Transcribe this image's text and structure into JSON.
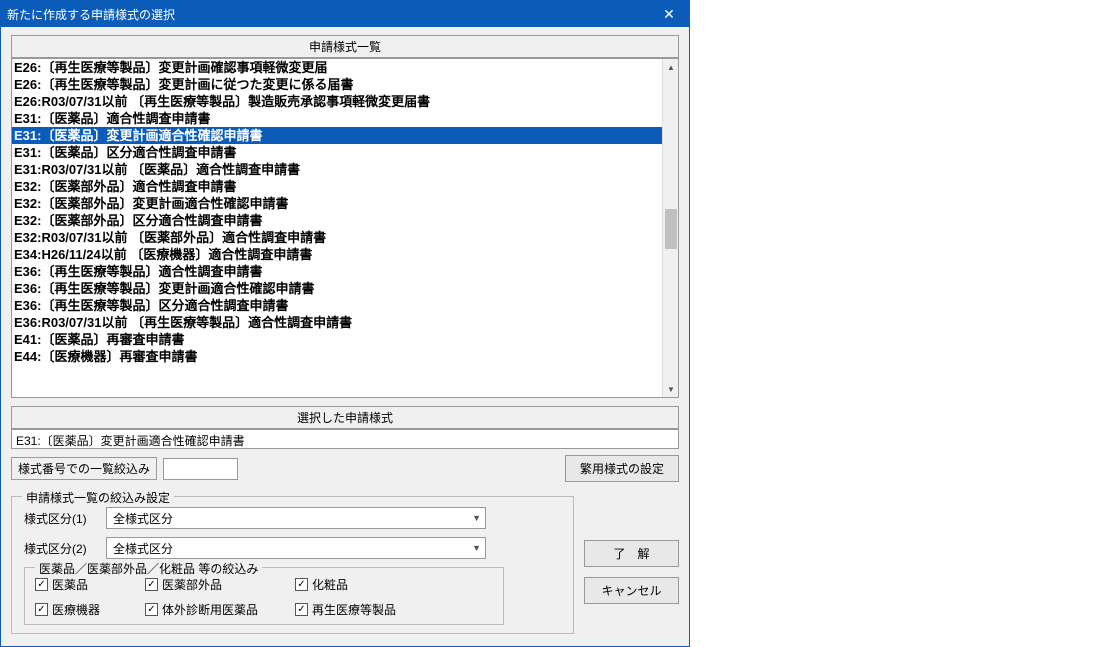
{
  "window": {
    "title": "新たに作成する申請様式の選択"
  },
  "list": {
    "header": "申請様式一覧",
    "items": [
      "E26:〔再生医療等製品〕変更計画確認事項軽微変更届",
      "E26:〔再生医療等製品〕変更計画に従つた変更に係る届書",
      "E26:R03/07/31以前 〔再生医療等製品〕製造販売承認事項軽微変更届書",
      "E31:〔医薬品〕適合性調査申請書",
      "E31:〔医薬品〕変更計画適合性確認申請書",
      "E31:〔医薬品〕区分適合性調査申請書",
      "E31:R03/07/31以前 〔医薬品〕適合性調査申請書",
      "E32:〔医薬部外品〕適合性調査申請書",
      "E32:〔医薬部外品〕変更計画適合性確認申請書",
      "E32:〔医薬部外品〕区分適合性調査申請書",
      "E32:R03/07/31以前 〔医薬部外品〕適合性調査申請書",
      "E34:H26/11/24以前 〔医療機器〕適合性調査申請書",
      "E36:〔再生医療等製品〕適合性調査申請書",
      "E36:〔再生医療等製品〕変更計画適合性確認申請書",
      "E36:〔再生医療等製品〕区分適合性調査申請書",
      "E36:R03/07/31以前 〔再生医療等製品〕適合性調査申請書",
      "E41:〔医薬品〕再審査申請書",
      "E44:〔医療機器〕再審査申請書"
    ],
    "selected_index": 4
  },
  "selected": {
    "header": "選択した申請様式",
    "value": "E31:〔医薬品〕変更計画適合性確認申請書"
  },
  "filter": {
    "label": "様式番号での一覧絞込み",
    "value": ""
  },
  "buttons": {
    "frequent": "繁用様式の設定",
    "ok": "了　解",
    "cancel": "キャンセル"
  },
  "narrow": {
    "legend": "申請様式一覧の絞込み設定",
    "combo1_label": "様式区分(1)",
    "combo1_value": "全様式区分",
    "combo2_label": "様式区分(2)",
    "combo2_value": "全様式区分",
    "inner_legend": "医薬品／医薬部外品／化粧品 等の絞込み",
    "checks": {
      "c1": "医薬品",
      "c2": "医薬部外品",
      "c3": "化粧品",
      "c4": "医療機器",
      "c5": "体外診断用医薬品",
      "c6": "再生医療等製品"
    }
  }
}
